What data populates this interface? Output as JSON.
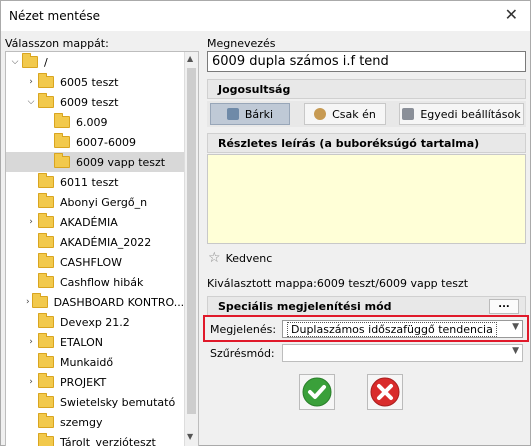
{
  "window": {
    "title": "Nézet mentése",
    "close": "✕"
  },
  "folder_label": "Válasszon mappát:",
  "tree": [
    {
      "label": "/",
      "expander": "⌵"
    },
    {
      "label": "6005 teszt",
      "expander": "›"
    },
    {
      "label": "6009 teszt",
      "expander": "⌵"
    },
    {
      "label": "6.009",
      "expander": ""
    },
    {
      "label": "6007-6009",
      "expander": ""
    },
    {
      "label": "6009 vapp teszt",
      "expander": ""
    },
    {
      "label": "6011 teszt",
      "expander": ""
    },
    {
      "label": "Abonyi Gergő_n",
      "expander": ""
    },
    {
      "label": "AKADÉMIA",
      "expander": "›"
    },
    {
      "label": "AKADÉMIA_2022",
      "expander": ""
    },
    {
      "label": "CASHFLOW",
      "expander": ""
    },
    {
      "label": "Cashflow hibák",
      "expander": ""
    },
    {
      "label": "DASHBOARD KONTRO...",
      "expander": "›"
    },
    {
      "label": "Devexp 21.2",
      "expander": ""
    },
    {
      "label": "ETALON",
      "expander": "›"
    },
    {
      "label": "Munkaidő",
      "expander": ""
    },
    {
      "label": "PROJEKT",
      "expander": "›"
    },
    {
      "label": "Swietelsky bemutató",
      "expander": ""
    },
    {
      "label": "szemgy",
      "expander": ""
    },
    {
      "label": "Tárolt_verzióteszt",
      "expander": ""
    }
  ],
  "name_label": "Megnevezés",
  "name_value": "6009 dupla számos i.f tend",
  "permissions": {
    "title": "Jogosultság",
    "buttons": [
      "Bárki",
      "Csak én",
      "Egyedi beállítások"
    ]
  },
  "description_title": "Részletes leírás (a buboréksúgó tartalma)",
  "favorite_label": "Kedvenc",
  "selected_folder_text": "Kiválasztott mappa:6009 teszt/6009 vapp teszt",
  "special": {
    "title": "Speciális megjelenítési mód",
    "more_button": "...",
    "display_label": "Megjelenés:",
    "display_value": "Duplaszámos időszafüggő tendencia",
    "filter_label": "Szűrésmód:",
    "filter_value": ""
  },
  "colors": {
    "highlight": "#e0192a",
    "ok_green": "#3aa03a",
    "cancel_red": "#d92b2b",
    "description_bg": "#ffffd7"
  }
}
